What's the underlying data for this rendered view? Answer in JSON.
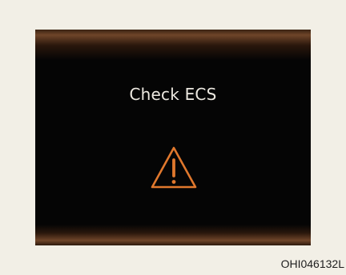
{
  "display": {
    "message": "Check ECS",
    "icon": "warning-icon",
    "accent_color": "#e0782d",
    "text_color": "#ece8e0",
    "background_color": "#050505"
  },
  "figure": {
    "code": "OHI046132L"
  }
}
